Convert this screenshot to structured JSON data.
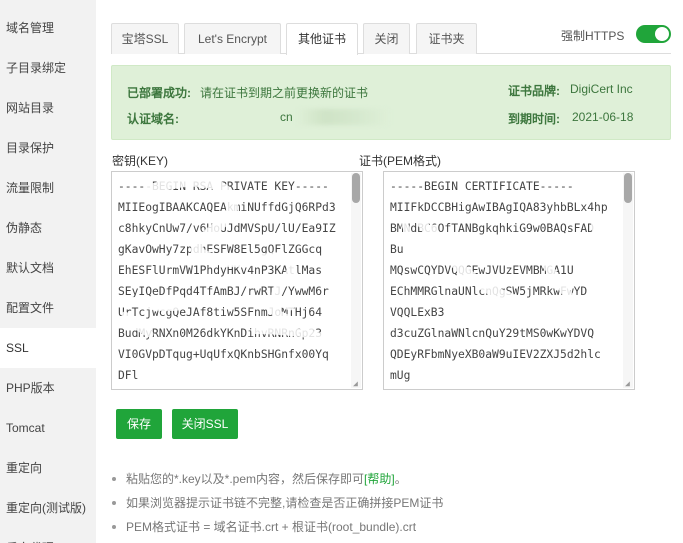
{
  "sidebar": {
    "items": [
      {
        "label": "域名管理"
      },
      {
        "label": "子目录绑定"
      },
      {
        "label": "网站目录"
      },
      {
        "label": "目录保护"
      },
      {
        "label": "流量限制"
      },
      {
        "label": "伪静态"
      },
      {
        "label": "默认文档"
      },
      {
        "label": "配置文件"
      },
      {
        "label": "SSL",
        "active": true
      },
      {
        "label": "PHP版本"
      },
      {
        "label": "Tomcat"
      },
      {
        "label": "重定向"
      },
      {
        "label": "重定向(测试版)"
      },
      {
        "label": "反向代理"
      }
    ]
  },
  "tabs": [
    {
      "label": "宝塔SSL"
    },
    {
      "label": "Let's Encrypt"
    },
    {
      "label": "其他证书",
      "active": true
    },
    {
      "label": "关闭"
    },
    {
      "label": "证书夹"
    }
  ],
  "https_toggle": {
    "label": "强制HTTPS",
    "on": true,
    "color": "#20a53a"
  },
  "alert": {
    "status_key": "已部署成功:",
    "status_value": "请在证书到期之前更换新的证书",
    "domain_key": "认证域名:",
    "domain_value": "cn",
    "brand_key": "证书品牌:",
    "brand_value": "DigiCert Inc",
    "expire_key": "到期时间:",
    "expire_value": "2021-06-18"
  },
  "key_field": {
    "label": "密钥(KEY)",
    "lines": [
      "-----BEGIN RSA PRIVATE KEY-----",
      "MIIEogIBAAKCAQEAkmiNUffdGjQ6RPd3",
      "c8hkyCnUw7/v6HoUJdMVSpU/lU/Ea9IZ",
      "gKavOwHy7zpdhESFW8El5gQFlZGGcq",
      "EhESFlUrmVW1PhdyHKv4nP3KAtlMas",
      "SEyIQeDfPqd4TfAmBJ/rwRTJ/YwwM6r",
      "UrTcjwcgQeJAf8tiw5SFnmJoMTHj64",
      "BudMyRNXn0M26dkYKnDihvRNRnGp23",
      "VI0GVpDTqug+UqUfxQKnbSHGnfx00Yq",
      "DFl"
    ]
  },
  "cert_field": {
    "label": "证书(PEM格式)",
    "lines": [
      "-----BEGIN CERTIFICATE-----",
      "MIIFkDCCBHigAwIBAgIQA83yhbBLx4hp",
      "BMNdBC6OfTANBgkqhkiG9w0BAQsFAD",
      "Bu",
      "MQswCQYDVQQGEwJVUzEVMBMGA1U",
      "EChMMRGlnaUNlcnQgSW5jMRkwFwYD",
      "VQQLExB3",
      "d3cuZGlnaWNlcnQuY29tMS0wKwYDVQ",
      "QDEyRFbmNyeXB0aW9uIEV2ZXJ5d2hlc",
      "mUg"
    ]
  },
  "buttons": {
    "save": "保存",
    "close_ssl": "关闭SSL"
  },
  "help": {
    "line1_prefix": "粘贴您的*.key以及*.pem内容，然后保存即可",
    "line1_link": "[帮助]",
    "line1_suffix": "。",
    "line2": "如果浏览器提示证书链不完整,请检查是否正确拼接PEM证书",
    "line3": "PEM格式证书 = 域名证书.crt + 根证书(root_bundle).crt"
  },
  "colors": {
    "accent": "#20a53a",
    "alert_bg": "#dff0d8",
    "alert_text": "#3c763d"
  }
}
